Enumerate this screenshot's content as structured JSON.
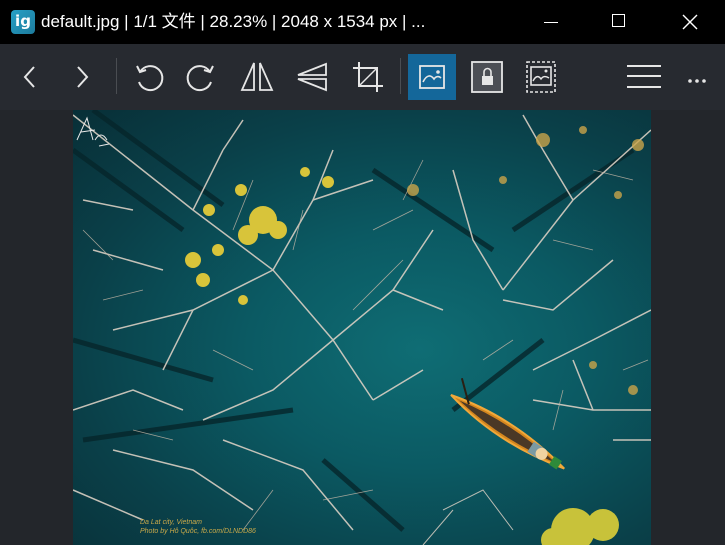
{
  "window": {
    "title": "default.jpg  |  1/1 文件  |  28.23%  |  2048 x 1534 px  |  ...",
    "app_icon_label": "ig",
    "controls": [
      "minimize-icon",
      "maximize-icon",
      "close-icon"
    ]
  },
  "toolbar": {
    "buttons": [
      {
        "name": "previous-button",
        "icon": "chevron-left-icon"
      },
      {
        "name": "next-button",
        "icon": "chevron-right-icon"
      },
      {
        "name": "rotate-left-button",
        "icon": "rotate-ccw-icon"
      },
      {
        "name": "rotate-right-button",
        "icon": "rotate-cw-icon"
      },
      {
        "name": "flip-horizontal-button",
        "icon": "flip-horizontal-icon"
      },
      {
        "name": "flip-vertical-button",
        "icon": "flip-vertical-icon"
      },
      {
        "name": "crop-button",
        "icon": "crop-icon"
      },
      {
        "name": "fit-image-button",
        "icon": "image-fit-icon",
        "active": true
      },
      {
        "name": "lock-zoom-button",
        "icon": "image-lock-icon"
      },
      {
        "name": "scale-to-fill-button",
        "icon": "image-fill-icon"
      },
      {
        "name": "main-menu-button",
        "icon": "hamburger-icon"
      },
      {
        "name": "more-button",
        "icon": "more-icon"
      }
    ],
    "accent_color": "#14679a"
  },
  "image": {
    "description_tags": [
      "aerial-photo",
      "boat",
      "trees",
      "water"
    ],
    "watermark_line1": "Da Lat city, Vietnam",
    "watermark_line2": "Photo by Hô Quôc, fb.com/DLNDD86"
  }
}
